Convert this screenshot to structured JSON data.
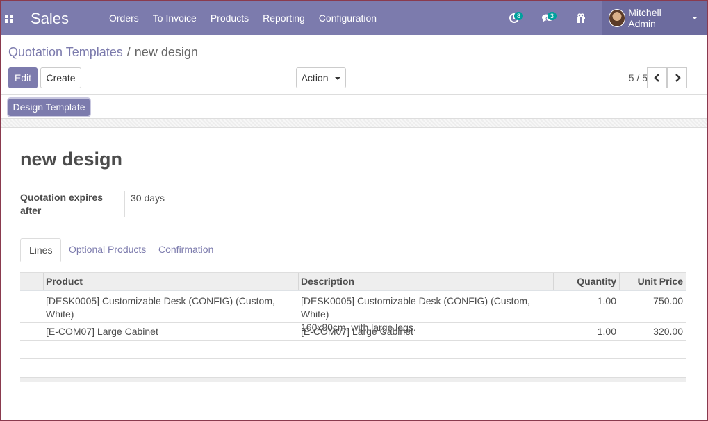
{
  "navbar": {
    "app_name": "Sales",
    "menu": [
      "Orders",
      "To Invoice",
      "Products",
      "Reporting",
      "Configuration"
    ],
    "activity_count": "8",
    "messages_count": "3",
    "user_name": "Mitchell Admin"
  },
  "breadcrumb": {
    "parent": "Quotation Templates",
    "separator": "/",
    "current": "new design"
  },
  "buttons": {
    "edit": "Edit",
    "create": "Create",
    "action": "Action",
    "design_template": "Design Template"
  },
  "pager": {
    "value": "5 / 5"
  },
  "record": {
    "title": "new design",
    "expires_label": "Quotation expires after",
    "expires_value": "30 days"
  },
  "tabs": [
    "Lines",
    "Optional Products",
    "Confirmation"
  ],
  "table": {
    "headers": {
      "product": "Product",
      "description": "Description",
      "quantity": "Quantity",
      "unit_price": "Unit Price"
    },
    "rows": [
      {
        "product": "[DESK0005] Customizable Desk (CONFIG) (Custom, White)",
        "description_line1": "[DESK0005] Customizable Desk (CONFIG) (Custom, White)",
        "description_line2": "160x80cm, with large legs.",
        "quantity": "1.00",
        "unit_price": "750.00"
      },
      {
        "product": "[E-COM07] Large Cabinet",
        "description_line1": "[E-COM07] Large Cabinet",
        "description_line2": "",
        "quantity": "1.00",
        "unit_price": "320.00"
      }
    ]
  },
  "colors": {
    "brand": "#7c7bad",
    "badge": "#00a09d"
  }
}
